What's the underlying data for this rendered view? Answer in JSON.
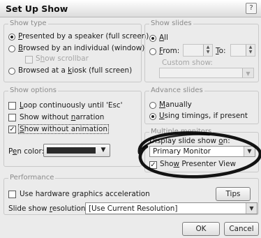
{
  "dialog": {
    "title": "Set Up Show",
    "help_icon": "question-mark-icon"
  },
  "show_type": {
    "legend": "Show type",
    "speaker_pre": "",
    "speaker_key": "P",
    "speaker_post": "resented by a speaker (full screen)",
    "individual_pre": "",
    "individual_key": "B",
    "individual_post": "rowsed by an individual (window)",
    "scrollbar_pre": "S",
    "scrollbar_key": "h",
    "scrollbar_post": "ow scrollbar",
    "kiosk_pre": "Browsed at a ",
    "kiosk_key": "k",
    "kiosk_post": "iosk (full screen)",
    "selected": "speaker"
  },
  "show_slides": {
    "legend": "Show slides",
    "all_pre": "",
    "all_key": "A",
    "all_post": "ll",
    "from_pre": "",
    "from_key": "F",
    "from_post": "rom:",
    "to_pre": "",
    "to_key": "T",
    "to_post": "o:",
    "custom_label": "Custom show:"
  },
  "show_options": {
    "legend": "Show options",
    "loop_pre": "",
    "loop_key": "L",
    "loop_post": "oop continuously until 'Esc'",
    "narration_pre": "Show without ",
    "narration_key": "n",
    "narration_post": "arration",
    "animation_pre": "",
    "animation_key": "S",
    "animation_post": "how without animation",
    "pen_pre": "P",
    "pen_key": "e",
    "pen_post": "n color:",
    "pen_color": "#2a2a2a"
  },
  "advance": {
    "legend": "Advance slides",
    "manual_pre": "",
    "manual_key": "M",
    "manual_post": "anually",
    "timings_pre": "",
    "timings_key": "U",
    "timings_post": "sing timings, if present"
  },
  "monitors": {
    "legend": "Multiple monitors",
    "display_pre": "Display slide show ",
    "display_key": "o",
    "display_post": "n:",
    "monitor_value": "Primary Monitor",
    "presenter_pre": "Sho",
    "presenter_key": "w",
    "presenter_post": " Presenter View"
  },
  "performance": {
    "legend": "Performance",
    "hw_label": "Use hardware graphics acceleration",
    "tips_label": "Tips",
    "res_pre": "Slide show ",
    "res_key": "r",
    "res_post": "esolution:",
    "res_value": "[Use Current Resolution]"
  },
  "buttons": {
    "ok": "OK",
    "cancel": "Cancel"
  }
}
